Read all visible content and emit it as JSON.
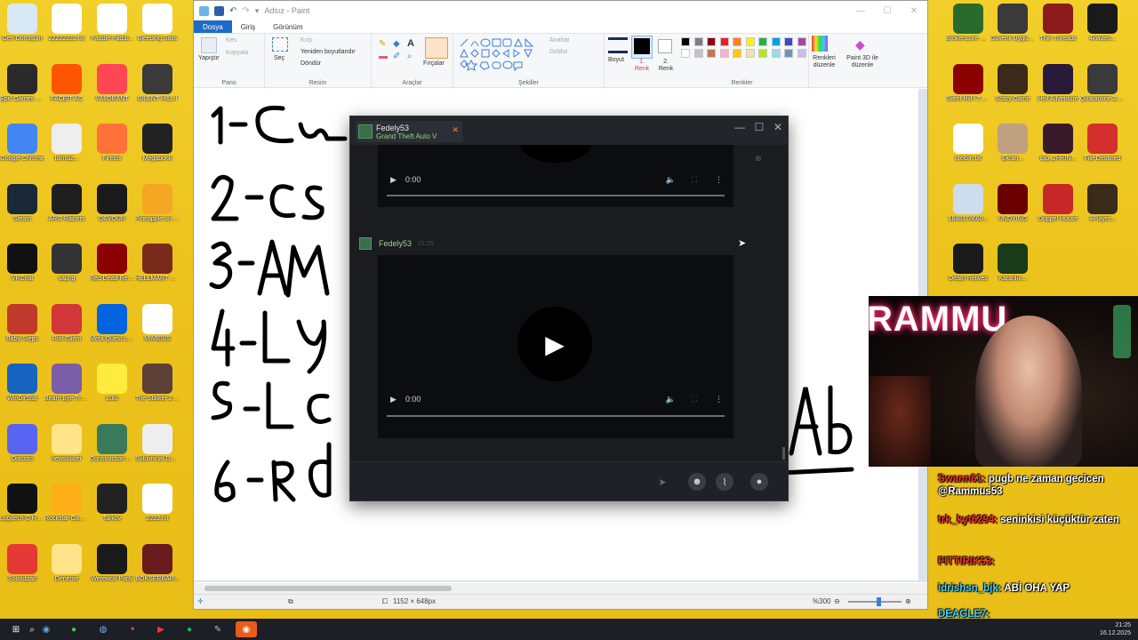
{
  "paint": {
    "title": "Adsız - Paint",
    "menu": {
      "file": "Dosya",
      "home": "Giriş",
      "view": "Görünüm"
    },
    "ribbon": {
      "paste": "Yapıştır",
      "cut": "Kes",
      "copy": "Kopyala",
      "select": "Seç",
      "crop": "Kırp",
      "resize": "Yeniden boyutlandır",
      "rotate": "Döndür",
      "brushes": "Fırçalar",
      "outline": "Anahat",
      "fill": "Doldur",
      "size": "Boyut",
      "color1": "1. Renk",
      "color2": "2. Renk",
      "edit_colors": "Renkleri düzenle",
      "edit_paint3d": "Paint 3D ile düzenle",
      "groups": {
        "clipboard": "Pano",
        "image": "Resim",
        "tools": "Araçlar",
        "shapes": "Şekiller",
        "colors": "Renkler"
      },
      "palette": [
        "#000000",
        "#7f7f7f",
        "#880015",
        "#ed1c24",
        "#ff7f27",
        "#fff200",
        "#22b14c",
        "#00a2e8",
        "#3f48cc",
        "#a349a4",
        "#ffffff",
        "#c3c3c3",
        "#b97a57",
        "#ffaec9",
        "#ffc90e",
        "#efe4b0",
        "#b5e61d",
        "#99d9ea",
        "#7092be",
        "#c8bfe7"
      ]
    },
    "canvas_lines": [
      "1-",
      "2-Cs",
      "3-AM",
      "4-Ly",
      "5-L",
      "6-Rd"
    ],
    "canvas_right_text": "Ab",
    "status": {
      "dimensions": "1152 × 648px",
      "zoom": "%300"
    }
  },
  "chat": {
    "contact_name": "Fedely53",
    "contact_game": "Grand Theft Auto V",
    "sender": "Fedely53",
    "time": "21:25",
    "video1_time": "0:00",
    "video2_time": "0:00"
  },
  "webcam": {
    "name_text": "RAMMU"
  },
  "stream_chat": [
    {
      "user": "Swann61:",
      "text": "pugb ne zaman gecicen @Rammus53"
    },
    {
      "user": "trk_kyt6294:",
      "text": "seninkisi küçüktür zaten"
    },
    {
      "user": "FITTIRIK53:",
      "text": ""
    },
    {
      "user": "idrishsn_bjk:",
      "text": "ABİ OHA YAP"
    },
    {
      "user": "DEAGLE7:",
      "text": ""
    }
  ],
  "desktop_icons": [
    {
      "label": "Geri Dönüşüm",
      "color": "#d9e8f5"
    },
    {
      "label": "22222222.txt",
      "color": "#ffffff"
    },
    {
      "label": "Paddle Paddl...",
      "color": "#ffffff"
    },
    {
      "label": "Bleeding Sails",
      "color": "#ffffff"
    },
    {
      "label": "Epic Games Launcher",
      "color": "#2a2a2a"
    },
    {
      "label": "FACEIT AC",
      "color": "#ff5500"
    },
    {
      "label": "VALORANT",
      "color": "#ff4655"
    },
    {
      "label": "SILENT HILL f",
      "color": "#3a3a3a"
    },
    {
      "label": "Google Chrome",
      "color": "#4285f4"
    },
    {
      "label": "İsimsiz...",
      "color": "#eeeeee"
    },
    {
      "label": "Firefox",
      "color": "#ff7139"
    },
    {
      "label": "Megabonk",
      "color": "#222222"
    },
    {
      "label": "Steam",
      "color": "#1b2838"
    },
    {
      "label": "ARC Raiders",
      "color": "#1f1f1f"
    },
    {
      "label": "DEVOUR",
      "color": "#1a1a1a"
    },
    {
      "label": "Pineapple on pizza",
      "color": "#f5a623"
    },
    {
      "label": "VRChat",
      "color": "#111111"
    },
    {
      "label": "sapng",
      "color": "#333333"
    },
    {
      "label": "Red Dead Redempti...",
      "color": "#8b0000"
    },
    {
      "label": "HELLMART Demo",
      "color": "#7a2a1a"
    },
    {
      "label": "Baby Steps",
      "color": "#c0392b"
    },
    {
      "label": "Riot Client",
      "color": "#d13639"
    },
    {
      "label": "Meta Quest Link",
      "color": "#0064e0"
    },
    {
      "label": "MIMESIS",
      "color": "#ffffff"
    },
    {
      "label": "WinDirStat",
      "color": "#1565c0"
    },
    {
      "label": "Beam Eye Tracker",
      "color": "#7b5ea7"
    },
    {
      "label": "Lulu",
      "color": "#ffeb3b"
    },
    {
      "label": "The Stalker 2 Demo",
      "color": "#5d4037"
    },
    {
      "label": "Discord",
      "color": "#5865f2"
    },
    {
      "label": "newsfolder",
      "color": "#ffe48a"
    },
    {
      "label": "ConstructionSimulator",
      "color": "#3a7a5a"
    },
    {
      "label": "Subliminal Demo",
      "color": "#eeeeee"
    },
    {
      "label": "Logitech G HUB",
      "color": "#111111"
    },
    {
      "label": "Rockstar Games...",
      "color": "#fcaf17"
    },
    {
      "label": "Tarkov",
      "color": "#222222"
    },
    {
      "label": "2222.txt",
      "color": "#ffffff"
    },
    {
      "label": "Soundpad",
      "color": "#e53935"
    },
    {
      "label": "Deneme",
      "color": "#ffe48a"
    },
    {
      "label": "Werewolf Party",
      "color": "#1a1a1a"
    },
    {
      "label": "BOKSERBAR...",
      "color": "#6a1b1b"
    }
  ],
  "right_icons": [
    {
      "label": "BrokenLore DON'T W...",
      "color": "#2a6a2a"
    },
    {
      "label": "Güvenli Uygulama",
      "color": "#3a3a3a"
    },
    {
      "label": "Thin Threads",
      "color": "#8b1a1a"
    },
    {
      "label": "4kvideo...",
      "color": "#1a1a1a"
    },
    {
      "label": "Silent Hill f Türkçe Ya...",
      "color": "#8b0000"
    },
    {
      "label": "Scary Game",
      "color": "#3a2a1a"
    },
    {
      "label": "Hell Adventure",
      "color": "#2a1a3a"
    },
    {
      "label": "Quarantine Zone The...",
      "color": "#3a3a3a"
    },
    {
      "label": "otelbin.txt",
      "color": "#ffffff"
    },
    {
      "label": "Ekran...",
      "color": "#c0a080"
    },
    {
      "label": "clip_2HKIN...",
      "color": "#3a1a2a"
    },
    {
      "label": "File Destined",
      "color": "#d32f2f"
    },
    {
      "label": "1688178660...",
      "color": "#ccddee"
    },
    {
      "label": "UNDYING",
      "color": "#6a0000"
    },
    {
      "label": "Doppel House",
      "color": "#c62828"
    },
    {
      "label": "4Player...",
      "color": "#3a2a1a"
    },
    {
      "label": "Death Relives",
      "color": "#1a1a1a"
    },
    {
      "label": "Karanlık...",
      "color": "#1a3a1a"
    }
  ],
  "tray": {
    "time": "21:25",
    "date": "16.12.2025"
  }
}
